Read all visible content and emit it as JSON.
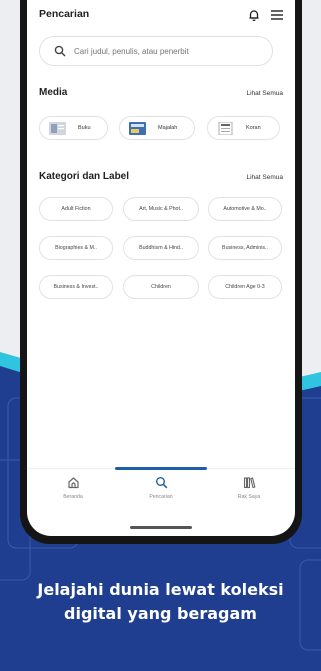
{
  "header": {
    "title": "Pencarian"
  },
  "search": {
    "placeholder": "Cari judul, penulis, atau penerbit"
  },
  "media": {
    "title": "Media",
    "see_all": "Lihat Semua",
    "items": [
      {
        "label": "Buku"
      },
      {
        "label": "Majalah"
      },
      {
        "label": "Koran"
      }
    ]
  },
  "categories": {
    "title": "Kategori dan Label",
    "see_all": "Lihat Semua",
    "items": [
      {
        "label": "Adult Fiction"
      },
      {
        "label": "Art, Music & Phot.."
      },
      {
        "label": "Automotive & Mo.."
      },
      {
        "label": "Biographies & M.."
      },
      {
        "label": "Buddhism & Hind.."
      },
      {
        "label": "Business, Adminis.."
      },
      {
        "label": "Business & Invest.."
      },
      {
        "label": "Children"
      },
      {
        "label": "Children Age 0-3"
      }
    ]
  },
  "nav": {
    "items": [
      {
        "label": "Beranda",
        "icon": "home-icon"
      },
      {
        "label": "Pencarian",
        "icon": "search-icon"
      },
      {
        "label": "Rak Saya",
        "icon": "bookshelf-icon"
      }
    ],
    "active": "Pencarian",
    "active_color": "#1f5fa8"
  },
  "tagline": {
    "line1": "Jelajahi dunia lewat koleksi",
    "line2": "digital yang beragam"
  },
  "colors": {
    "background_dark": "#1d3d8f",
    "wave_accent": "#2fc4e0",
    "screen": "#ffffff"
  }
}
